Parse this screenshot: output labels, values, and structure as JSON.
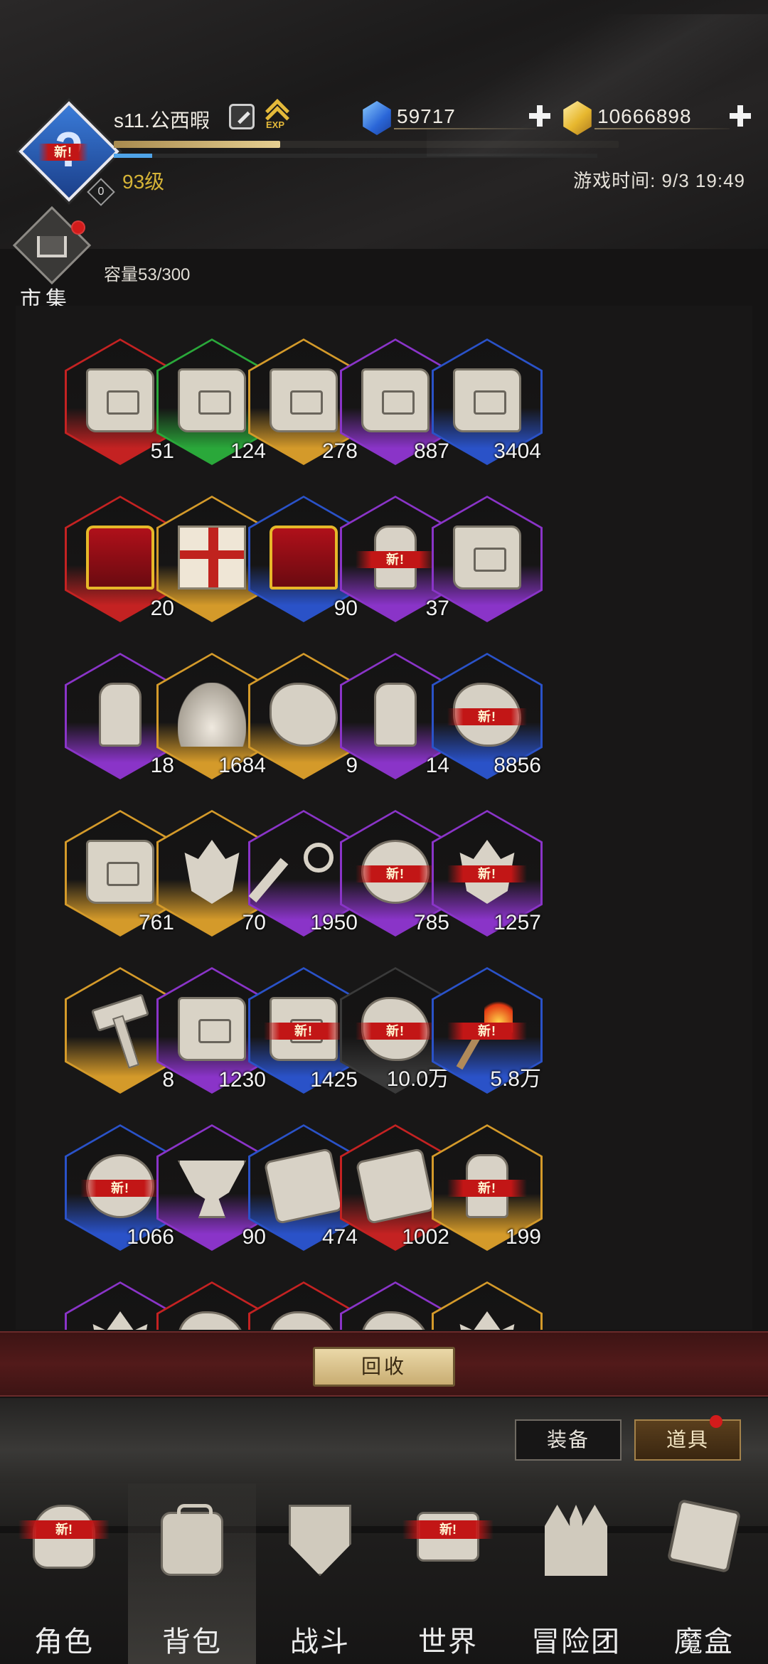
{
  "player": {
    "name": "s11.公西暇",
    "level_label": "93级",
    "new_badge": "新!",
    "rank_badge": "0",
    "exp_icon_text": "EXP",
    "exp_progress": 0.33,
    "secondary_progress": 0.08
  },
  "currencies": [
    {
      "icon": "blue-diamond-icon",
      "value": "59717",
      "color": "#2a66d8"
    },
    {
      "icon": "gold-coin-icon",
      "value": "10666898",
      "color": "#e6b527"
    }
  ],
  "game_time": "游戏时间: 9/3 19:49",
  "market": {
    "label": "市集",
    "has_notification": true
  },
  "inventory": {
    "capacity_label": "容量53/300",
    "new_label": "新!",
    "items": [
      {
        "icon": "map-scroll-icon",
        "qty": "51",
        "rarity": "red",
        "is_new": false
      },
      {
        "icon": "map-scroll-icon",
        "qty": "124",
        "rarity": "green",
        "is_new": false
      },
      {
        "icon": "map-scroll-icon",
        "qty": "278",
        "rarity": "orange",
        "is_new": false
      },
      {
        "icon": "map-scroll-icon",
        "qty": "887",
        "rarity": "purple",
        "is_new": false
      },
      {
        "icon": "map-scroll-icon",
        "qty": "3404",
        "rarity": "blue",
        "is_new": false
      },
      {
        "icon": "red-crystal-chest-icon",
        "qty": "20",
        "rarity": "red",
        "is_new": false
      },
      {
        "icon": "gift-box-icon",
        "qty": "",
        "rarity": "orange",
        "is_new": false
      },
      {
        "icon": "red-crystal-chest-icon",
        "qty": "90",
        "rarity": "blue",
        "is_new": false
      },
      {
        "icon": "hourglass-icon",
        "qty": "37",
        "rarity": "purple",
        "is_new": true
      },
      {
        "icon": "star-scroll-icon",
        "qty": "",
        "rarity": "purple",
        "is_new": false
      },
      {
        "icon": "clock-icon",
        "qty": "18",
        "rarity": "purple",
        "is_new": false
      },
      {
        "icon": "flame-icon",
        "qty": "1684",
        "rarity": "orange",
        "is_new": false
      },
      {
        "icon": "ore-icon",
        "qty": "9",
        "rarity": "orange",
        "is_new": false
      },
      {
        "icon": "potion-jar-icon",
        "qty": "14",
        "rarity": "purple",
        "is_new": false
      },
      {
        "icon": "ore-icon",
        "qty": "8856",
        "rarity": "blue",
        "is_new": true
      },
      {
        "icon": "treasure-chest-icon",
        "qty": "761",
        "rarity": "orange",
        "is_new": false
      },
      {
        "icon": "feather-blade-icon",
        "qty": "70",
        "rarity": "orange",
        "is_new": false
      },
      {
        "icon": "key-icon",
        "qty": "1950",
        "rarity": "purple",
        "is_new": false
      },
      {
        "icon": "ring-icon",
        "qty": "785",
        "rarity": "purple",
        "is_new": true
      },
      {
        "icon": "crystal-cluster-icon",
        "qty": "1257",
        "rarity": "purple",
        "is_new": true
      },
      {
        "icon": "hammer-icon",
        "qty": "8",
        "rarity": "orange",
        "is_new": false
      },
      {
        "icon": "sealed-scroll-icon",
        "qty": "1230",
        "rarity": "purple",
        "is_new": false
      },
      {
        "icon": "scroll-icon",
        "qty": "1425",
        "rarity": "blue",
        "is_new": true
      },
      {
        "icon": "horn-icon",
        "qty": "10.0万",
        "rarity": "gray",
        "is_new": true
      },
      {
        "icon": "torch-icon",
        "qty": "5.8万",
        "rarity": "blue",
        "is_new": true
      },
      {
        "icon": "compass-icon",
        "qty": "1066",
        "rarity": "blue",
        "is_new": true
      },
      {
        "icon": "chalice-icon",
        "qty": "90",
        "rarity": "purple",
        "is_new": false
      },
      {
        "icon": "rune-tablet-icon",
        "qty": "474",
        "rarity": "blue",
        "is_new": false
      },
      {
        "icon": "fang-emblem-icon",
        "qty": "1002",
        "rarity": "red",
        "is_new": false
      },
      {
        "icon": "banner-icon",
        "qty": "199",
        "rarity": "orange",
        "is_new": true
      },
      {
        "icon": "gem-icon",
        "qty": "",
        "rarity": "purple",
        "is_new": false
      },
      {
        "icon": "spiked-shell-icon",
        "qty": "",
        "rarity": "red",
        "is_new": false
      },
      {
        "icon": "meteor-ore-icon",
        "qty": "",
        "rarity": "red",
        "is_new": false
      },
      {
        "icon": "stone-icon",
        "qty": "",
        "rarity": "purple",
        "is_new": false
      },
      {
        "icon": "shard-icon",
        "qty": "",
        "rarity": "orange",
        "is_new": false
      }
    ]
  },
  "recycle_button": "回收",
  "filter_tabs": [
    {
      "label": "装备",
      "active": false
    },
    {
      "label": "道具",
      "active": true,
      "has_notification": true
    }
  ],
  "bottom_nav": [
    {
      "label": "角色",
      "icon": "helmet-icon",
      "is_new": true,
      "active": false
    },
    {
      "label": "背包",
      "icon": "backpack-icon",
      "is_new": false,
      "active": true
    },
    {
      "label": "战斗",
      "icon": "shield-sword-icon",
      "is_new": false,
      "active": false
    },
    {
      "label": "世界",
      "icon": "world-scroll-icon",
      "is_new": true,
      "active": false
    },
    {
      "label": "冒险团",
      "icon": "castle-icon",
      "is_new": false,
      "active": false
    },
    {
      "label": "魔盒",
      "icon": "magic-cube-icon",
      "is_new": false,
      "active": false
    }
  ],
  "colors": {
    "red": "#c42222",
    "green": "#2aa83a",
    "orange": "#d49a2a",
    "purple": "#8a34c8",
    "blue": "#2a52c8",
    "gray": "#3a3a3a",
    "level_text": "#d6b437",
    "new_tag": "#c21616"
  }
}
